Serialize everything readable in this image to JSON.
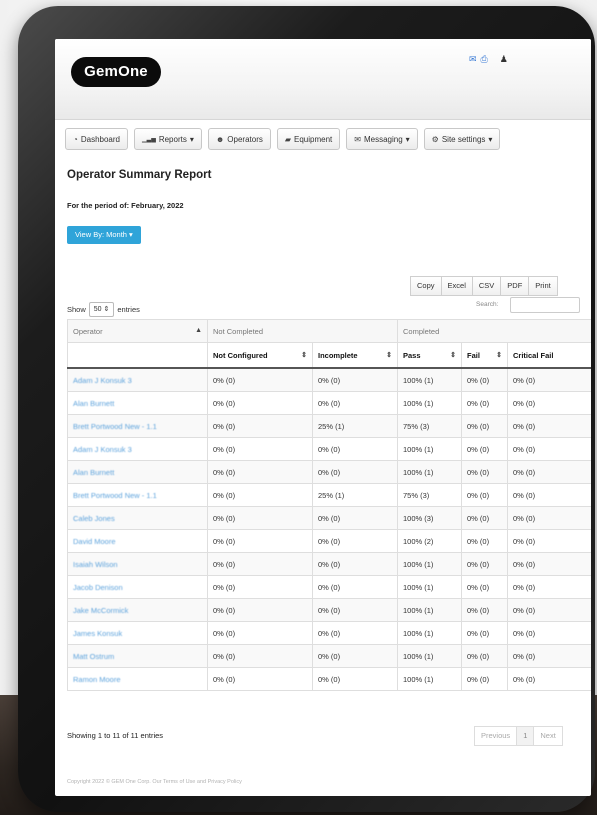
{
  "header": {
    "logo": "GemOne",
    "icons": [
      "mail-icon",
      "print-icon",
      "user-icon"
    ]
  },
  "nav": [
    {
      "label": "Dashboard",
      "icon": "dashboard-icon",
      "glyph": "◔"
    },
    {
      "label": "Reports",
      "icon": "bar-chart-icon",
      "glyph": "▁▃▅",
      "caret": "▾"
    },
    {
      "label": "Operators",
      "icon": "users-icon",
      "glyph": "☻"
    },
    {
      "label": "Equipment",
      "icon": "truck-icon",
      "glyph": "▰"
    },
    {
      "label": "Messaging",
      "icon": "megaphone-icon",
      "glyph": "✉",
      "caret": "▾"
    },
    {
      "label": "Site settings",
      "icon": "gear-icon",
      "glyph": "⚙",
      "caret": "▾"
    }
  ],
  "page": {
    "title": "Operator Summary Report",
    "period": "For the period of: February, 2022",
    "view_by": "View By: Month ▾"
  },
  "toolbar": {
    "exports": [
      "Copy",
      "Excel",
      "CSV",
      "PDF",
      "Print"
    ],
    "search_label": "Search:",
    "show_label": "Show",
    "page_length": "50",
    "entries_label": "entries"
  },
  "table": {
    "group_headers": {
      "operator": "Operator",
      "not_completed": "Not Completed",
      "completed": "Completed"
    },
    "columns": [
      "Not Configured",
      "Incomplete",
      "Pass",
      "Fail",
      "Critical Fail"
    ],
    "rows": [
      {
        "name": "Adam J Konsuk 3",
        "not_configured": "0% (0)",
        "incomplete": "0% (0)",
        "pass": "100% (1)",
        "fail": "0% (0)",
        "critical_fail": "0% (0)"
      },
      {
        "name": "Alan Burnett",
        "not_configured": "0% (0)",
        "incomplete": "0% (0)",
        "pass": "100% (1)",
        "fail": "0% (0)",
        "critical_fail": "0% (0)"
      },
      {
        "name": "Brett Portwood New - 1.1",
        "not_configured": "0% (0)",
        "incomplete": "25% (1)",
        "pass": "75% (3)",
        "fail": "0% (0)",
        "critical_fail": "0% (0)"
      },
      {
        "name": "Adam J Konsuk 3",
        "not_configured": "0% (0)",
        "incomplete": "0% (0)",
        "pass": "100% (1)",
        "fail": "0% (0)",
        "critical_fail": "0% (0)"
      },
      {
        "name": "Alan Burnett",
        "not_configured": "0% (0)",
        "incomplete": "0% (0)",
        "pass": "100% (1)",
        "fail": "0% (0)",
        "critical_fail": "0% (0)"
      },
      {
        "name": "Brett Portwood New - 1.1",
        "not_configured": "0% (0)",
        "incomplete": "25% (1)",
        "pass": "75% (3)",
        "fail": "0% (0)",
        "critical_fail": "0% (0)"
      },
      {
        "name": "Caleb Jones",
        "not_configured": "0% (0)",
        "incomplete": "0% (0)",
        "pass": "100% (3)",
        "fail": "0% (0)",
        "critical_fail": "0% (0)"
      },
      {
        "name": "David Moore",
        "not_configured": "0% (0)",
        "incomplete": "0% (0)",
        "pass": "100% (2)",
        "fail": "0% (0)",
        "critical_fail": "0% (0)"
      },
      {
        "name": "Isaiah Wilson",
        "not_configured": "0% (0)",
        "incomplete": "0% (0)",
        "pass": "100% (1)",
        "fail": "0% (0)",
        "critical_fail": "0% (0)"
      },
      {
        "name": "Jacob Denison",
        "not_configured": "0% (0)",
        "incomplete": "0% (0)",
        "pass": "100% (1)",
        "fail": "0% (0)",
        "critical_fail": "0% (0)"
      },
      {
        "name": "Jake McCormick",
        "not_configured": "0% (0)",
        "incomplete": "0% (0)",
        "pass": "100% (1)",
        "fail": "0% (0)",
        "critical_fail": "0% (0)"
      },
      {
        "name": "James Konsuk",
        "not_configured": "0% (0)",
        "incomplete": "0% (0)",
        "pass": "100% (1)",
        "fail": "0% (0)",
        "critical_fail": "0% (0)"
      },
      {
        "name": "Matt Ostrum",
        "not_configured": "0% (0)",
        "incomplete": "0% (0)",
        "pass": "100% (1)",
        "fail": "0% (0)",
        "critical_fail": "0% (0)"
      },
      {
        "name": "Ramon Moore",
        "not_configured": "0% (0)",
        "incomplete": "0% (0)",
        "pass": "100% (1)",
        "fail": "0% (0)",
        "critical_fail": "0% (0)"
      }
    ]
  },
  "footer_info": {
    "showing": "Showing 1 to 11 of 11 entries",
    "previous": "Previous",
    "page": "1",
    "next": "Next",
    "copyright": "Copyright 2022 © GEM One Corp. Our Terms of Use and Privacy Policy"
  },
  "colors": {
    "accent": "#2fa4d9",
    "link": "#5ea3dc"
  }
}
